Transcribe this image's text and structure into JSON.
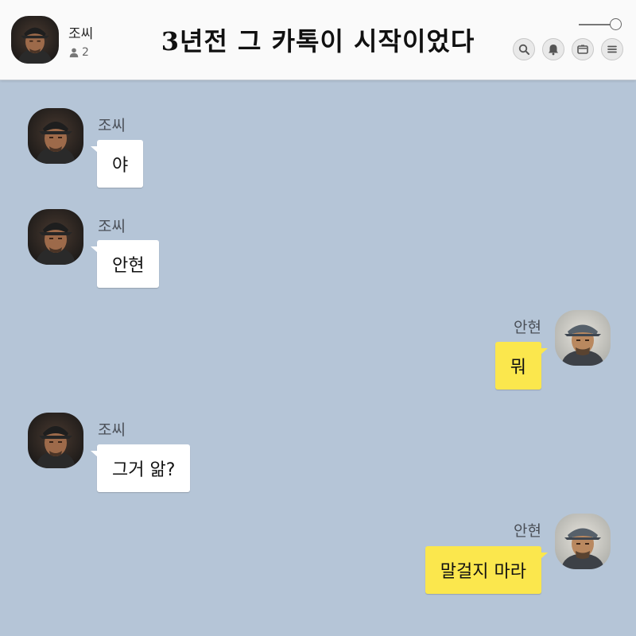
{
  "header": {
    "chat_name": "조씨",
    "member_count": "2",
    "title": "3년전 그 카톡이 시작이었다",
    "icons": [
      "search-icon",
      "bell-icon",
      "drawer-icon",
      "menu-icon"
    ]
  },
  "colors": {
    "background": "#b5c5d7",
    "incoming_bubble": "#ffffff",
    "outgoing_bubble": "#fbe74d"
  },
  "messages": [
    {
      "sender": "조씨",
      "text": "야",
      "direction": "incoming"
    },
    {
      "sender": "조씨",
      "text": "안현",
      "direction": "incoming"
    },
    {
      "sender": "안현",
      "text": "뭐",
      "direction": "outgoing"
    },
    {
      "sender": "조씨",
      "text": "그거 앎?",
      "direction": "incoming"
    },
    {
      "sender": "안현",
      "text": "말걸지 마라",
      "direction": "outgoing"
    }
  ]
}
